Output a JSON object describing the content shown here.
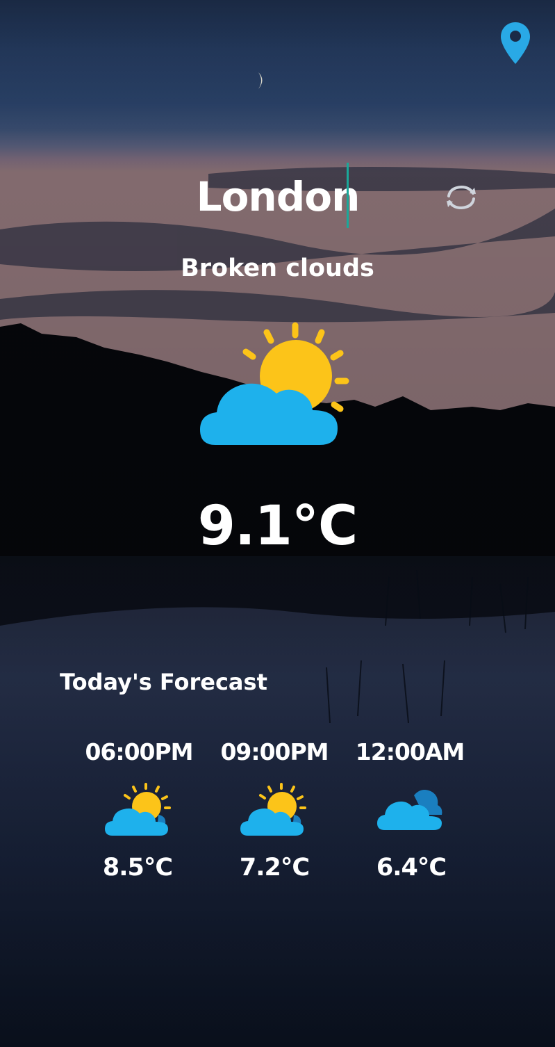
{
  "location": {
    "city": "London"
  },
  "current": {
    "description": "Broken clouds",
    "temperature": "9.1°C",
    "icon": "sun-behind-cloud-icon"
  },
  "forecast": {
    "title": "Today's Forecast",
    "items": [
      {
        "time": "06:00PM",
        "temperature": "8.5°C",
        "icon": "sun-behind-cloud-icon"
      },
      {
        "time": "09:00PM",
        "temperature": "7.2°C",
        "icon": "sun-behind-cloud-icon"
      },
      {
        "time": "12:00AM",
        "temperature": "6.4°C",
        "icon": "cloud-icon"
      }
    ]
  },
  "colors": {
    "accent": "#29a9e6",
    "cloud": "#1eb1ec",
    "cloud_shadow": "#1a7fc0",
    "sun": "#fcc419",
    "caret": "#1aa89a"
  }
}
